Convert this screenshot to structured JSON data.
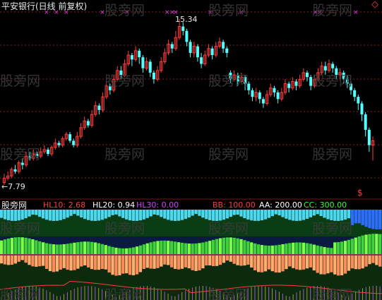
{
  "header": {
    "title": "平安银行(日线 前复权)",
    "diamond_icon": "diamond-icon"
  },
  "main_chart": {
    "high_label": "15.34",
    "low_label": "←7.79",
    "signal_label": "$",
    "candles": [
      [
        7.9,
        8.1,
        7.8,
        8.3
      ],
      [
        8.1,
        8.2,
        8.0,
        8.4
      ],
      [
        8.2,
        8.5,
        8.1,
        8.6
      ],
      [
        8.5,
        8.4,
        8.3,
        8.7
      ],
      [
        8.4,
        8.8,
        8.3,
        8.9
      ],
      [
        8.8,
        8.7,
        8.5,
        9.0
      ],
      [
        8.7,
        9.1,
        8.6,
        9.3
      ],
      [
        9.1,
        9.0,
        8.9,
        9.3
      ],
      [
        9.0,
        9.2,
        8.9,
        9.4
      ],
      [
        9.2,
        9.1,
        9.0,
        9.3
      ],
      [
        9.1,
        9.3,
        9.0,
        9.5
      ],
      [
        9.3,
        9.4,
        9.2,
        9.6
      ],
      [
        9.4,
        9.2,
        9.1,
        9.5
      ],
      [
        9.2,
        9.5,
        9.1,
        9.6
      ],
      [
        9.5,
        9.7,
        9.4,
        9.9
      ],
      [
        9.7,
        9.6,
        9.5,
        9.8
      ],
      [
        9.6,
        9.9,
        9.5,
        10.0
      ],
      [
        9.9,
        10.1,
        9.8,
        10.2
      ],
      [
        10.1,
        9.8,
        9.7,
        10.2
      ],
      [
        9.8,
        9.6,
        9.5,
        9.9
      ],
      [
        9.6,
        10.0,
        9.5,
        10.2
      ],
      [
        10.0,
        10.4,
        9.9,
        10.6
      ],
      [
        10.4,
        10.7,
        10.3,
        10.9
      ],
      [
        10.7,
        10.5,
        10.4,
        10.8
      ],
      [
        10.5,
        11.0,
        10.4,
        11.2
      ],
      [
        11.0,
        11.4,
        10.9,
        11.6
      ],
      [
        11.4,
        11.2,
        11.0,
        11.5
      ],
      [
        11.2,
        11.8,
        11.1,
        12.0
      ],
      [
        11.8,
        12.3,
        11.7,
        12.5
      ],
      [
        12.3,
        12.1,
        11.9,
        12.4
      ],
      [
        12.1,
        12.6,
        12.0,
        12.8
      ],
      [
        12.6,
        13.0,
        12.5,
        13.2
      ],
      [
        13.0,
        12.8,
        12.6,
        13.2
      ],
      [
        12.8,
        13.3,
        12.7,
        13.5
      ],
      [
        13.3,
        13.7,
        13.2,
        13.9
      ],
      [
        13.7,
        13.5,
        13.2,
        13.8
      ],
      [
        13.5,
        13.9,
        13.4,
        14.1
      ],
      [
        13.9,
        13.6,
        13.3,
        14.0
      ],
      [
        13.6,
        13.1,
        12.9,
        13.7
      ],
      [
        13.1,
        13.4,
        13.0,
        13.6
      ],
      [
        13.4,
        12.9,
        12.7,
        13.5
      ],
      [
        12.9,
        12.6,
        12.4,
        13.0
      ],
      [
        12.6,
        13.0,
        12.5,
        13.2
      ],
      [
        13.0,
        13.4,
        12.9,
        13.6
      ],
      [
        13.4,
        13.8,
        13.3,
        14.0
      ],
      [
        13.8,
        14.2,
        13.7,
        14.4
      ],
      [
        14.2,
        14.0,
        13.8,
        14.3
      ],
      [
        14.0,
        14.5,
        13.9,
        14.8
      ],
      [
        14.5,
        15.0,
        14.4,
        15.34
      ],
      [
        15.0,
        14.8,
        14.6,
        15.2
      ],
      [
        14.8,
        14.3,
        14.1,
        14.9
      ],
      [
        14.3,
        13.8,
        13.6,
        14.4
      ],
      [
        13.8,
        14.1,
        13.6,
        14.3
      ],
      [
        14.1,
        13.6,
        13.4,
        14.2
      ],
      [
        13.6,
        13.3,
        13.1,
        13.8
      ],
      [
        13.3,
        13.7,
        13.2,
        13.9
      ],
      [
        13.7,
        14.0,
        13.6,
        14.2
      ],
      [
        14.0,
        13.7,
        13.5,
        14.1
      ],
      [
        13.7,
        14.1,
        13.6,
        14.3
      ],
      [
        14.1,
        14.3,
        14.0,
        14.5
      ],
      [
        14.3,
        14.0,
        13.8,
        14.4
      ],
      [
        14.0,
        13.8,
        13.6,
        14.1
      ],
      [
        12.9,
        12.6,
        12.4,
        13.0
      ],
      [
        12.6,
        12.8,
        12.5,
        13.0
      ],
      [
        12.8,
        12.5,
        12.3,
        12.9
      ],
      [
        12.5,
        12.7,
        12.4,
        12.9
      ],
      [
        12.7,
        12.4,
        12.1,
        12.8
      ],
      [
        12.4,
        12.1,
        11.9,
        12.5
      ],
      [
        12.1,
        11.8,
        11.6,
        12.2
      ],
      [
        11.8,
        12.0,
        11.6,
        12.2
      ],
      [
        12.0,
        11.7,
        11.5,
        12.1
      ],
      [
        11.7,
        11.5,
        11.3,
        11.8
      ],
      [
        11.5,
        11.9,
        11.4,
        12.1
      ],
      [
        11.9,
        12.2,
        11.8,
        12.4
      ],
      [
        12.2,
        12.0,
        11.8,
        12.3
      ],
      [
        12.0,
        11.7,
        11.5,
        12.1
      ],
      [
        11.7,
        12.0,
        11.6,
        12.2
      ],
      [
        12.0,
        12.4,
        11.9,
        12.6
      ],
      [
        12.4,
        12.2,
        12.0,
        12.5
      ],
      [
        12.2,
        12.5,
        12.1,
        12.7
      ],
      [
        12.5,
        12.3,
        12.1,
        12.6
      ],
      [
        12.3,
        12.6,
        12.2,
        12.8
      ],
      [
        12.6,
        12.9,
        12.5,
        13.1
      ],
      [
        12.9,
        12.7,
        12.5,
        13.0
      ],
      [
        12.7,
        12.3,
        12.1,
        12.8
      ],
      [
        12.3,
        12.6,
        12.2,
        12.8
      ],
      [
        12.6,
        12.9,
        12.5,
        13.1
      ],
      [
        12.9,
        13.2,
        12.8,
        13.4
      ],
      [
        13.2,
        13.0,
        12.8,
        13.4
      ],
      [
        13.0,
        13.3,
        12.9,
        13.5
      ],
      [
        13.3,
        13.1,
        12.9,
        13.4
      ],
      [
        13.1,
        12.8,
        12.6,
        13.2
      ],
      [
        12.8,
        12.9,
        12.6,
        13.1
      ],
      [
        12.9,
        12.6,
        12.4,
        13.0
      ],
      [
        12.6,
        12.4,
        12.2,
        12.8
      ],
      [
        12.4,
        12.1,
        11.9,
        12.5
      ],
      [
        12.1,
        11.8,
        11.6,
        12.2
      ],
      [
        11.8,
        11.5,
        11.2,
        11.9
      ],
      [
        11.5,
        11.0,
        10.7,
        11.6
      ],
      [
        11.0,
        10.3,
        10.0,
        11.1
      ],
      [
        10.3,
        9.6,
        9.3,
        10.4
      ],
      [
        9.6,
        9.8,
        8.9,
        10.0
      ]
    ]
  },
  "indicator": {
    "label": "股旁网",
    "hl10_label": "HL10:",
    "hl10_value": "2.68",
    "hl20_label": "HL20:",
    "hl20_value": "0.94",
    "hl30_label": "HL30:",
    "hl30_value": "0.00",
    "bb_label": "BB:",
    "bb_value": "100.00",
    "aa_label": "AA:",
    "aa_value": "200.00",
    "cc_label": "CC:",
    "cc_value": "300.00"
  },
  "watermark": "股旁网",
  "colors": {
    "up": "#ff3c3c",
    "down": "#54ffff",
    "hl10": "#ff3c3c",
    "hl20": "#ffffff",
    "hl30": "#cc44ff",
    "bb": "#ff3c3c",
    "aa": "#ffffff",
    "cc": "#33ff33",
    "grid": "#8a1f1f",
    "marker": "#e040e0"
  }
}
